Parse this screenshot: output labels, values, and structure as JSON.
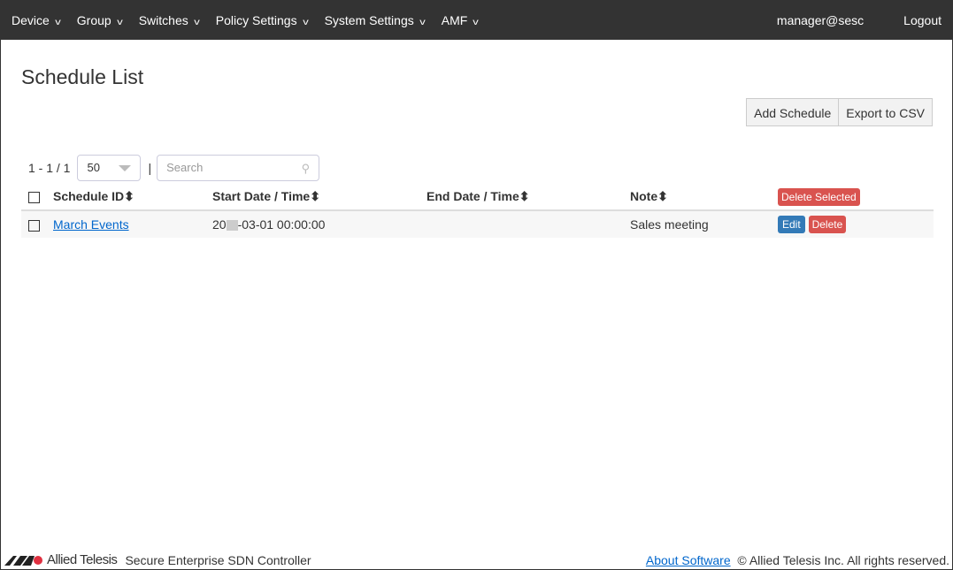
{
  "nav": {
    "items": [
      "Device",
      "Group",
      "Switches",
      "Policy Settings",
      "System Settings",
      "AMF"
    ],
    "user": "manager@sesc",
    "logout": "Logout"
  },
  "page": {
    "title": "Schedule List",
    "add_label": "Add Schedule",
    "export_label": "Export to CSV"
  },
  "pager": {
    "range": "1 - 1 / 1",
    "per_page": "50",
    "separator": "|",
    "search_placeholder": "Search"
  },
  "table": {
    "headers": [
      "Schedule ID",
      "Start Date / Time",
      "End Date / Time",
      "Note"
    ],
    "sort_icon": "⬍",
    "delete_selected": "Delete Selected",
    "rows": [
      {
        "id": "March Events",
        "start_prefix": "20",
        "start_suffix": "-03-01 00:00:00",
        "end": "",
        "note": "Sales meeting",
        "edit": "Edit",
        "delete": "Delete"
      }
    ]
  },
  "footer": {
    "logo": "Allied Telesis",
    "product": "Secure Enterprise SDN Controller",
    "about": "About Software",
    "copyright": "© Allied Telesis Inc. All rights reserved."
  }
}
